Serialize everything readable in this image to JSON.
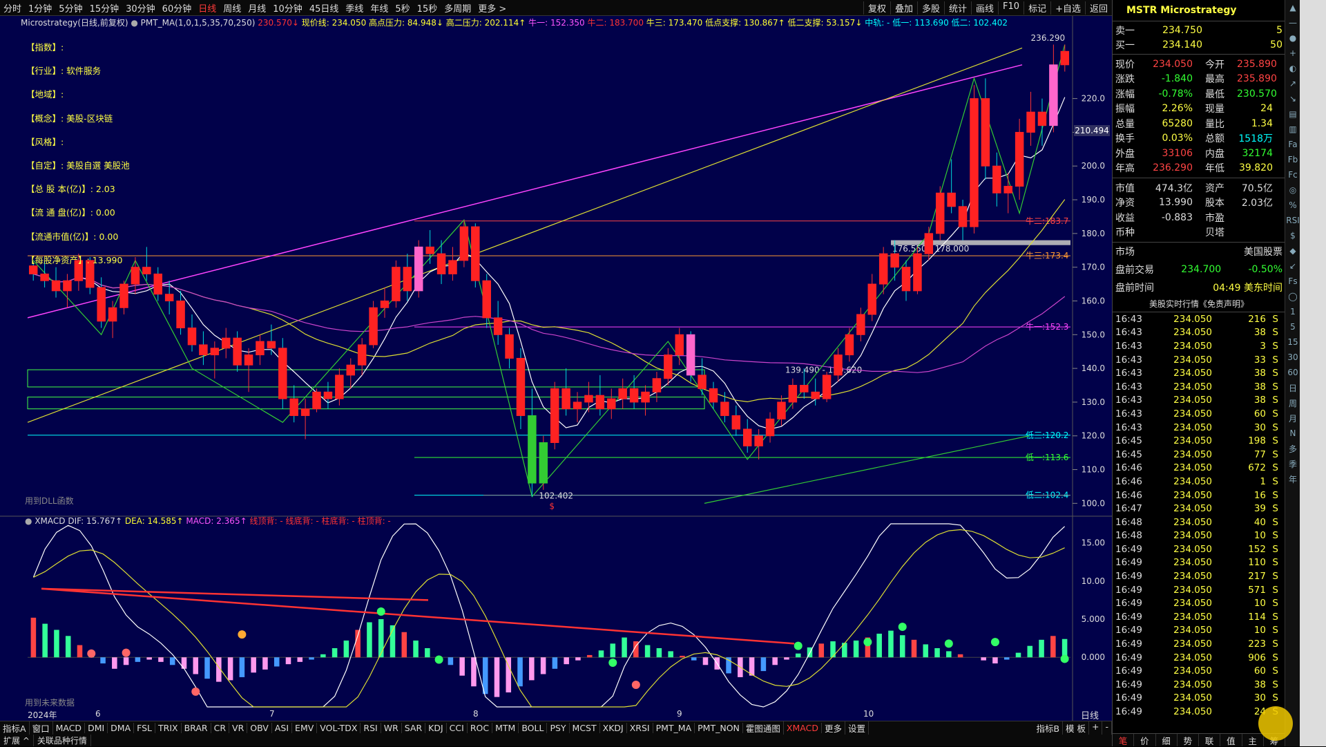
{
  "top_tabs": [
    "分时",
    "1分钟",
    "5分钟",
    "15分钟",
    "30分钟",
    "60分钟",
    "日线",
    "周线",
    "月线",
    "10分钟",
    "45日线",
    "季线",
    "年线",
    "5秒",
    "15秒",
    "多周期",
    "更多 >"
  ],
  "top_tabs_active": "日线",
  "top_right": [
    "复权",
    "叠加",
    "多股",
    "统计",
    "画线",
    "F10",
    "标记",
    "+自选",
    "返回"
  ],
  "status": {
    "name": "Microstrategy(日线,前复权)",
    "ind": "PMT_MA(1,0,1,5,35,70,250)",
    "v1": "230.570↓",
    "v2": "现价线: 234.050",
    "v3": "高点压力: 84.948↓",
    "v4": "高二压力: 202.114↑",
    "v5": "牛一: 152.350",
    "v6": "牛二: 183.700",
    "v7": "牛三: 173.470",
    "v8": "低点支撑: 130.867↑",
    "v9": "低二支撑: 53.157↓",
    "v10": "中轨: -",
    "v11": "低一: 113.690",
    "v12": "低二: 102.402"
  },
  "info": [
    "【指数】:",
    "【行业】: 软件服务",
    "【地域】:",
    "【概念】: 美股-区块链",
    "【风格】:",
    "【自定】: 美股自選 美股池",
    "【总 股 本(亿)】: 2.03",
    "【流 通 盘(亿)】: 0.00",
    "【流通市值(亿)】: 0.00",
    "【每股净资产】: 13.990"
  ],
  "dll_note": "用到DLL函数",
  "future_note": "用到未来数据",
  "macd_head": {
    "name": "XMACD",
    "dif": "DIF: 15.767↑",
    "dea": "DEA: 14.585↑",
    "macd": "MACD: 2.365↑",
    "a": "线顶背: -",
    "b": "线底背: -",
    "c": "柱底背: -",
    "d": "柱顶背: -"
  },
  "price_axis": [
    "220.0",
    "210.0",
    "200.0",
    "190.0",
    "180.0",
    "170.0",
    "160.0",
    "150.0",
    "140.0",
    "130.0",
    "120.0",
    "110.0",
    "100.0"
  ],
  "price_badge": "210.494",
  "macd_axis": [
    "15.00",
    "10.00",
    "5.000",
    "0.000"
  ],
  "date_axis": [
    "2024年",
    "6",
    "7",
    "8",
    "9",
    "10"
  ],
  "day_label": "日线",
  "chart_labels": {
    "high": "236.290",
    "low": "102.402",
    "box1": "176.550 - 178.000",
    "box2": "139.490 - 139.620",
    "niu2": "牛二:183.7",
    "niu3": "牛三:173.4",
    "niu1": "牛一:152.3",
    "di3": "低三:120.2",
    "di1": "低一:113.6",
    "di2": "低二:102.4"
  },
  "indicator_tabs": [
    "指标A",
    "窗口",
    "MACD",
    "DMI",
    "DMA",
    "FSL",
    "TRIX",
    "BRAR",
    "CR",
    "VR",
    "OBV",
    "ASI",
    "EMV",
    "VOL-TDX",
    "RSI",
    "WR",
    "SAR",
    "KDJ",
    "CCI",
    "ROC",
    "MTM",
    "BOLL",
    "PSY",
    "MCST",
    "XKDJ",
    "XRSI",
    "PMT_MA",
    "PMT_NON",
    "霍图通图",
    "XMACD",
    "更多",
    "设置"
  ],
  "indicator_active": "XMACD",
  "indicator_right": [
    "指标B",
    "模 板",
    "+",
    "-"
  ],
  "bottom_tabs": [
    "扩展 ^",
    "关联品种行情"
  ],
  "panel": {
    "title": "MSTR Microstrategy",
    "sell1": {
      "label": "卖一",
      "price": "234.750",
      "vol": "5"
    },
    "buy1": {
      "label": "买一",
      "price": "234.140",
      "vol": "50"
    },
    "quote": [
      {
        "l": "现价",
        "v": "234.050",
        "vc": "#ff4444",
        "l2": "今开",
        "v2": "235.890",
        "v2c": "#ff4444"
      },
      {
        "l": "涨跌",
        "v": "-1.840",
        "vc": "#33ff33",
        "l2": "最高",
        "v2": "235.890",
        "v2c": "#ff4444"
      },
      {
        "l": "涨幅",
        "v": "-0.78%",
        "vc": "#33ff33",
        "l2": "最低",
        "v2": "230.570",
        "v2c": "#33ff33"
      },
      {
        "l": "振幅",
        "v": "2.26%",
        "vc": "#ffff44",
        "l2": "现量",
        "v2": "24",
        "v2c": "#ffff44"
      },
      {
        "l": "总量",
        "v": "65280",
        "vc": "#ffff44",
        "l2": "量比",
        "v2": "1.34",
        "v2c": "#ffff44"
      },
      {
        "l": "换手",
        "v": "0.03%",
        "vc": "#ffff44",
        "l2": "总额",
        "v2": "1518万",
        "v2c": "#00ffff"
      },
      {
        "l": "外盘",
        "v": "33106",
        "vc": "#ff4444",
        "l2": "内盘",
        "v2": "32174",
        "v2c": "#33ff33"
      },
      {
        "l": "年高",
        "v": "236.290",
        "vc": "#ff4444",
        "l2": "年低",
        "v2": "39.820",
        "v2c": "#ffff44"
      }
    ],
    "fund": [
      {
        "l": "市值",
        "v": "474.3亿",
        "l2": "资产",
        "v2": "70.5亿"
      },
      {
        "l": "净资",
        "v": "13.990",
        "l2": "股本",
        "v2": "2.03亿"
      },
      {
        "l": "收益",
        "v": "-0.883",
        "l2": "市盈",
        "v2": ""
      },
      {
        "l": "币种",
        "v": "",
        "l2": "贝塔",
        "v2": ""
      }
    ],
    "market_label": "市场",
    "market_value": "美国股票",
    "pre_label": "盘前交易",
    "pre_price": "234.700",
    "pre_pct": "-0.50%",
    "pre_time_label": "盘前时间",
    "pre_time": "04:49 美东时间",
    "disclaimer": "美股实时行情《免责声明》",
    "ticks": [
      [
        "16:43",
        "234.050",
        "216",
        "S"
      ],
      [
        "16:43",
        "234.050",
        "38",
        "S"
      ],
      [
        "16:43",
        "234.050",
        "3",
        "S"
      ],
      [
        "16:43",
        "234.050",
        "33",
        "S"
      ],
      [
        "16:43",
        "234.050",
        "38",
        "S"
      ],
      [
        "16:43",
        "234.050",
        "38",
        "S"
      ],
      [
        "16:43",
        "234.050",
        "38",
        "S"
      ],
      [
        "16:43",
        "234.050",
        "60",
        "S"
      ],
      [
        "16:43",
        "234.050",
        "30",
        "S"
      ],
      [
        "16:45",
        "234.050",
        "198",
        "S"
      ],
      [
        "16:45",
        "234.050",
        "77",
        "S"
      ],
      [
        "16:46",
        "234.050",
        "672",
        "S"
      ],
      [
        "16:46",
        "234.050",
        "1",
        "S"
      ],
      [
        "16:46",
        "234.050",
        "16",
        "S"
      ],
      [
        "16:47",
        "234.050",
        "39",
        "S"
      ],
      [
        "16:48",
        "234.050",
        "40",
        "S"
      ],
      [
        "16:48",
        "234.050",
        "10",
        "S"
      ],
      [
        "16:49",
        "234.050",
        "152",
        "S"
      ],
      [
        "16:49",
        "234.050",
        "110",
        "S"
      ],
      [
        "16:49",
        "234.050",
        "217",
        "S"
      ],
      [
        "16:49",
        "234.050",
        "571",
        "S"
      ],
      [
        "16:49",
        "234.050",
        "10",
        "S"
      ],
      [
        "16:49",
        "234.050",
        "114",
        "S"
      ],
      [
        "16:49",
        "234.050",
        "10",
        "S"
      ],
      [
        "16:49",
        "234.050",
        "223",
        "S"
      ],
      [
        "16:49",
        "234.050",
        "906",
        "S"
      ],
      [
        "16:49",
        "234.050",
        "60",
        "S"
      ],
      [
        "16:49",
        "234.050",
        "38",
        "S"
      ],
      [
        "16:49",
        "234.050",
        "30",
        "S"
      ],
      [
        "16:49",
        "234.050",
        "24",
        "S"
      ]
    ],
    "bottom_tabs": [
      "笔",
      "价",
      "细",
      "势",
      "联",
      "值",
      "主",
      "筹"
    ],
    "bottom_active": "笔"
  },
  "candles": [
    [
      170.4,
      171,
      166,
      168
    ],
    [
      168,
      172,
      164,
      166
    ],
    [
      166,
      170,
      161,
      163
    ],
    [
      163,
      168,
      158,
      166
    ],
    [
      166,
      174,
      163,
      172
    ],
    [
      172,
      173,
      162,
      164
    ],
    [
      164,
      167,
      152,
      154
    ],
    [
      154,
      160,
      149,
      158
    ],
    [
      158,
      166,
      156,
      165
    ],
    [
      165,
      173,
      162,
      170
    ],
    [
      170,
      176,
      166,
      168
    ],
    [
      168,
      170,
      160,
      162
    ],
    [
      162,
      166,
      156,
      160
    ],
    [
      160,
      163,
      150,
      152
    ],
    [
      152,
      156,
      145,
      147
    ],
    [
      147,
      151,
      141,
      144
    ],
    [
      144,
      148,
      137,
      146
    ],
    [
      146,
      152,
      143,
      149
    ],
    [
      149,
      151,
      139,
      141
    ],
    [
      141,
      146,
      133,
      144
    ],
    [
      144,
      150,
      141,
      148
    ],
    [
      148,
      153,
      144,
      146
    ],
    [
      146,
      149,
      128,
      131
    ],
    [
      131,
      135,
      124,
      126
    ],
    [
      126,
      131,
      119,
      128
    ],
    [
      128,
      134,
      127,
      133
    ],
    [
      133,
      136,
      128,
      131
    ],
    [
      131,
      140,
      129,
      138
    ],
    [
      138,
      143,
      134,
      141
    ],
    [
      141,
      149,
      138,
      147
    ],
    [
      147,
      160,
      146,
      158
    ],
    [
      158,
      164,
      155,
      160
    ],
    [
      160,
      172,
      158,
      170
    ],
    [
      170,
      174,
      160,
      163
    ],
    [
      163,
      178,
      161,
      176
    ],
    [
      176,
      181,
      171,
      174
    ],
    [
      174,
      178,
      165,
      168
    ],
    [
      168,
      176,
      166,
      172
    ],
    [
      172,
      184,
      170,
      182
    ],
    [
      182,
      183,
      164,
      166
    ],
    [
      166,
      168,
      152,
      155
    ],
    [
      155,
      160,
      147,
      150
    ],
    [
      150,
      152,
      140,
      143
    ],
    [
      143,
      146,
      122,
      126
    ],
    [
      126,
      134,
      102,
      106
    ],
    [
      106,
      120,
      104,
      118
    ],
    [
      118,
      136,
      116,
      134
    ],
    [
      134,
      140,
      126,
      128
    ],
    [
      128,
      133,
      124,
      130
    ],
    [
      130,
      136,
      127,
      132
    ],
    [
      132,
      138,
      126,
      128
    ],
    [
      128,
      134,
      125,
      131
    ],
    [
      131,
      137,
      128,
      134
    ],
    [
      134,
      138,
      128,
      130
    ],
    [
      130,
      135,
      126,
      133
    ],
    [
      133,
      139,
      130,
      137
    ],
    [
      137,
      146,
      135,
      144
    ],
    [
      144,
      152,
      141,
      150
    ],
    [
      150,
      151,
      136,
      138
    ],
    [
      138,
      143,
      132,
      134
    ],
    [
      134,
      136,
      128,
      130
    ],
    [
      130,
      133,
      124,
      126
    ],
    [
      126,
      129,
      120,
      122
    ],
    [
      122,
      125,
      115,
      117
    ],
    [
      117,
      122,
      113,
      120
    ],
    [
      120,
      127,
      118,
      125
    ],
    [
      125,
      132,
      123,
      130
    ],
    [
      130,
      137,
      128,
      135
    ],
    [
      135,
      140,
      131,
      133
    ],
    [
      133,
      137,
      129,
      131
    ],
    [
      131,
      139,
      130,
      138
    ],
    [
      138,
      146,
      136,
      144
    ],
    [
      144,
      152,
      142,
      150
    ],
    [
      150,
      158,
      148,
      156
    ],
    [
      156,
      168,
      154,
      165
    ],
    [
      165,
      176,
      162,
      174
    ],
    [
      174,
      178,
      166,
      170
    ],
    [
      170,
      172,
      160,
      163
    ],
    [
      163,
      176,
      162,
      174
    ],
    [
      174,
      182,
      172,
      180
    ],
    [
      180,
      194,
      178,
      192
    ],
    [
      192,
      202,
      186,
      188
    ],
    [
      188,
      190,
      178,
      182
    ],
    [
      182,
      224,
      180,
      220
    ],
    [
      220,
      226,
      196,
      200
    ],
    [
      200,
      204,
      188,
      192
    ],
    [
      192,
      198,
      186,
      194
    ],
    [
      194,
      214,
      190,
      210
    ],
    [
      210,
      222,
      206,
      216
    ],
    [
      216,
      220,
      206,
      212
    ],
    [
      212,
      236,
      210,
      230
    ],
    [
      230,
      236,
      228,
      234
    ]
  ],
  "macd_bars": [
    5.2,
    4.4,
    3.6,
    2.8,
    1.6,
    0.4,
    -0.8,
    -1.5,
    -1.0,
    -0.6,
    -0.3,
    -0.6,
    -1.0,
    -1.5,
    -2.2,
    -2.8,
    -3.2,
    -3.0,
    -2.6,
    -2.0,
    -1.6,
    -1.2,
    -0.9,
    -0.6,
    -0.3,
    0.4,
    1.2,
    2.2,
    3.6,
    4.6,
    5.0,
    4.2,
    3.3,
    2.2,
    1.2,
    0.1,
    -1.0,
    -2.4,
    -3.8,
    -4.8,
    -5.2,
    -4.6,
    -3.8,
    -3.0,
    -2.2,
    -1.5,
    -0.9,
    -0.4,
    0.3,
    0.9,
    1.8,
    2.6,
    2.1,
    1.6,
    1.2,
    0.8,
    0.2,
    -0.4,
    -1.0,
    -1.6,
    -2.1,
    -2.6,
    -2.4,
    -1.8,
    -1.0,
    -0.3,
    0.5,
    1.3,
    1.8,
    2.1,
    1.9,
    2.2,
    2.6,
    3.1,
    3.5,
    2.9,
    2.3,
    1.7,
    1.2,
    0.8,
    0.4,
    0.0,
    -0.4,
    -0.8,
    -0.3,
    0.6,
    1.5,
    2.3,
    2.8,
    2.4
  ]
}
